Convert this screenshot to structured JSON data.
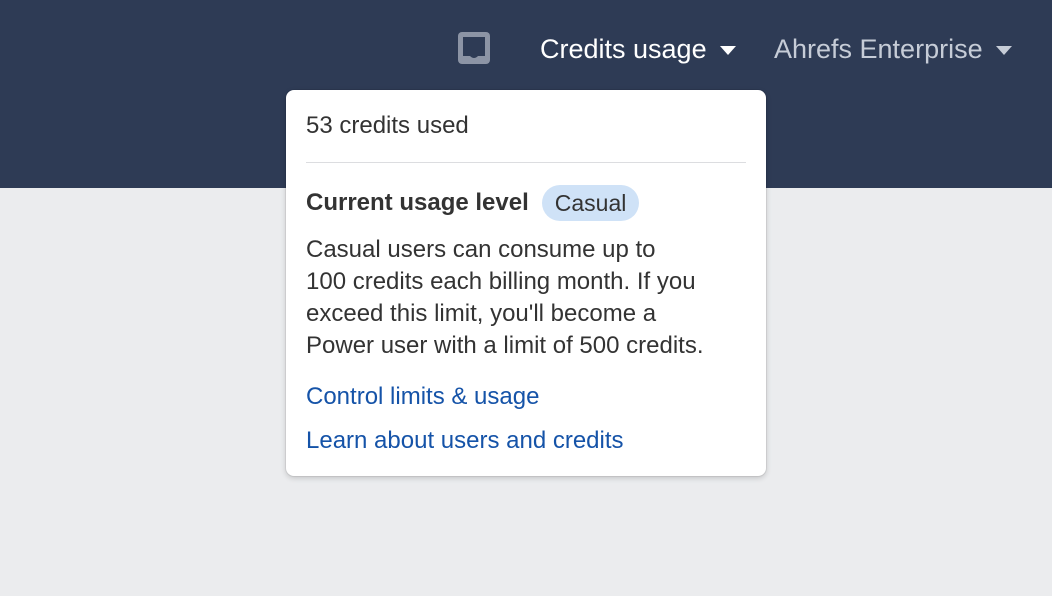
{
  "header": {
    "inbox_icon": "inbox-icon",
    "credits_menu_label": "Credits usage",
    "account_menu_label": "Ahrefs Enterprise",
    "caret_icon": "caret-down-icon"
  },
  "popover": {
    "credits_used": "53 credits used",
    "usage_level_label": "Current usage level",
    "usage_level_badge": "Casual",
    "description_lines": [
      "Casual users can consume up to",
      "100 credits each billing month. If you",
      "exceed this limit, you'll become a",
      "Power user with a limit of 500 credits."
    ],
    "links": {
      "control_limits": "Control limits & usage",
      "learn_more": "Learn about users and credits"
    }
  },
  "colors": {
    "topbar_bg": "#2e3b55",
    "page_bg": "#ebecee",
    "badge_bg": "#cfe2f7",
    "link": "#1553a8"
  }
}
